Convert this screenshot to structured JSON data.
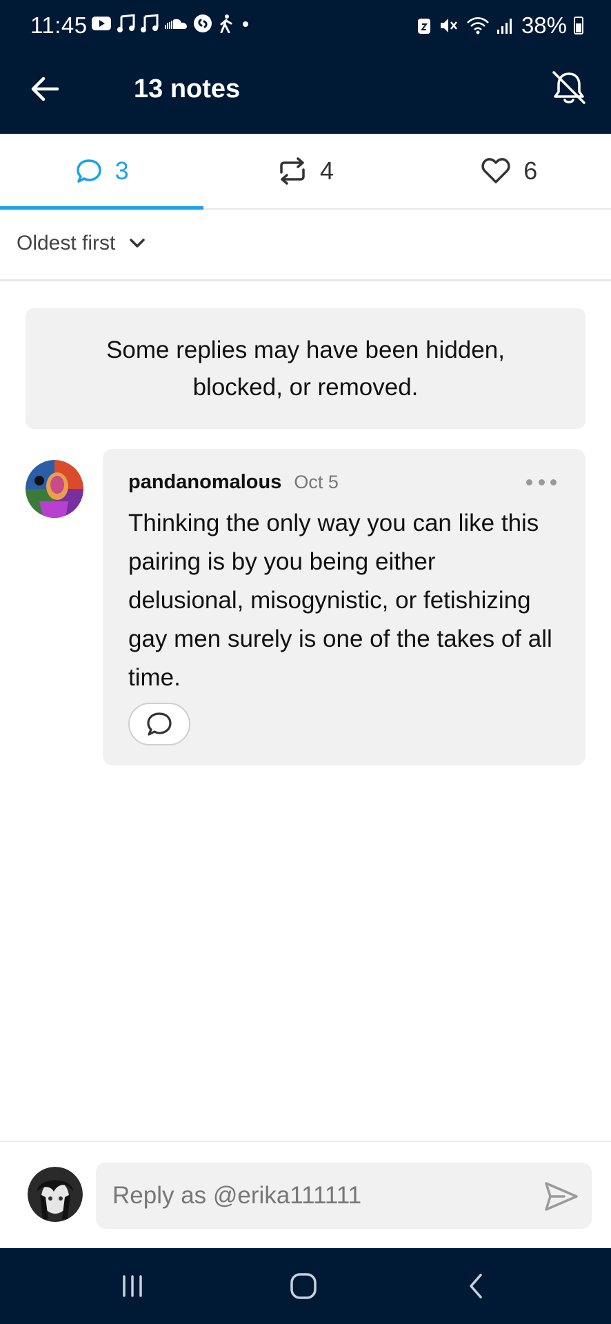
{
  "status_bar": {
    "time": "11:45",
    "battery": "38%",
    "icons_left": [
      "youtube-icon",
      "music-note-icon",
      "music-note-icon",
      "soundcloud-icon",
      "shazam-icon",
      "walking-icon",
      "dot-icon"
    ],
    "icons_right": [
      "lock-icon",
      "mute-icon",
      "wifi-icon",
      "signal-icon",
      "battery-icon"
    ]
  },
  "header": {
    "title": "13 notes",
    "back_icon": "arrow-left-icon",
    "mute_icon": "bell-off-icon"
  },
  "tabs": [
    {
      "icon": "comment-icon",
      "count": "3",
      "active": true
    },
    {
      "icon": "reblog-icon",
      "count": "4",
      "active": false
    },
    {
      "icon": "heart-icon",
      "count": "6",
      "active": false
    }
  ],
  "sort": {
    "label": "Oldest first",
    "icon": "chevron-down-icon"
  },
  "notice": {
    "text": "Some replies may have been hidden, blocked, or removed."
  },
  "reply": {
    "username": "pandanomalous",
    "date": "Oct 5",
    "text": "Thinking the only way you can like this pairing is by you being either delusional, misogynistic, or fetishizing gay men surely is one of the takes of all time."
  },
  "composer": {
    "placeholder": "Reply as @erika111111",
    "send_icon": "send-icon"
  },
  "nav": [
    "recent-apps-icon",
    "home-icon",
    "back-icon"
  ],
  "colors": {
    "header_bg": "#001935",
    "accent": "#1aa3e8",
    "card_bg": "#f1f1f1"
  }
}
